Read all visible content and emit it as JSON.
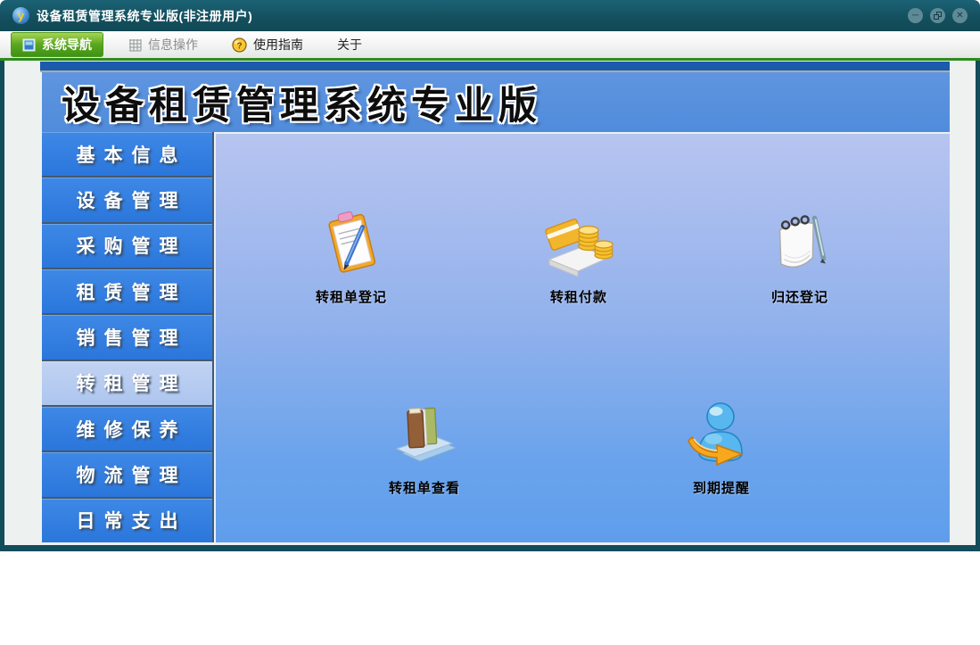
{
  "window": {
    "title": "设备租赁管理系统专业版(非注册用户)",
    "logo_glyph": "y",
    "controls": [
      {
        "name": "minimize-button",
        "glyph": "─"
      },
      {
        "name": "restore-button",
        "glyph": ""
      },
      {
        "name": "close-button",
        "glyph": "✕"
      }
    ]
  },
  "menubar": {
    "items": [
      {
        "label": "系统导航",
        "icon": "nav-square-icon",
        "state": "active"
      },
      {
        "label": "信息操作",
        "icon": "grid-icon",
        "state": "disabled"
      },
      {
        "label": "使用指南",
        "icon": "help-sphere-icon",
        "state": "normal"
      },
      {
        "label": "关于",
        "icon": "",
        "state": "normal"
      }
    ],
    "help_glyph": "?"
  },
  "banner": {
    "title": "设备租赁管理系统专业版"
  },
  "sidebar": {
    "items": [
      {
        "label": "基本信息",
        "selected": false
      },
      {
        "label": "设备管理",
        "selected": false
      },
      {
        "label": "采购管理",
        "selected": false
      },
      {
        "label": "租赁管理",
        "selected": false
      },
      {
        "label": "销售管理",
        "selected": false
      },
      {
        "label": "转租管理",
        "selected": true
      },
      {
        "label": "维修保养",
        "selected": false
      },
      {
        "label": "物流管理",
        "selected": false
      },
      {
        "label": "日常支出",
        "selected": false
      }
    ]
  },
  "shortcuts": [
    {
      "label": "转租单登记",
      "icon": "clipboard-pen-icon"
    },
    {
      "label": "转租付款",
      "icon": "card-coins-icon"
    },
    {
      "label": "归还登记",
      "icon": "notepad-pen-icon"
    },
    {
      "label": "转租单查看",
      "icon": "books-icon"
    },
    {
      "label": "到期提醒",
      "icon": "person-arrow-icon"
    }
  ],
  "colors": {
    "titlebar": "#14505f",
    "menu_active_green": "#4f9f1d",
    "menu_underline": "#2e8b1d",
    "strip_blue": "#1c5aac",
    "banner_blue": "#5590dd",
    "sidebar_blue": "#2e7de0",
    "sidebar_selected": "#b8cdf0",
    "content_top": "#b7c4f0",
    "content_bottom": "#5f9eec",
    "window_border": "#134c5b"
  }
}
